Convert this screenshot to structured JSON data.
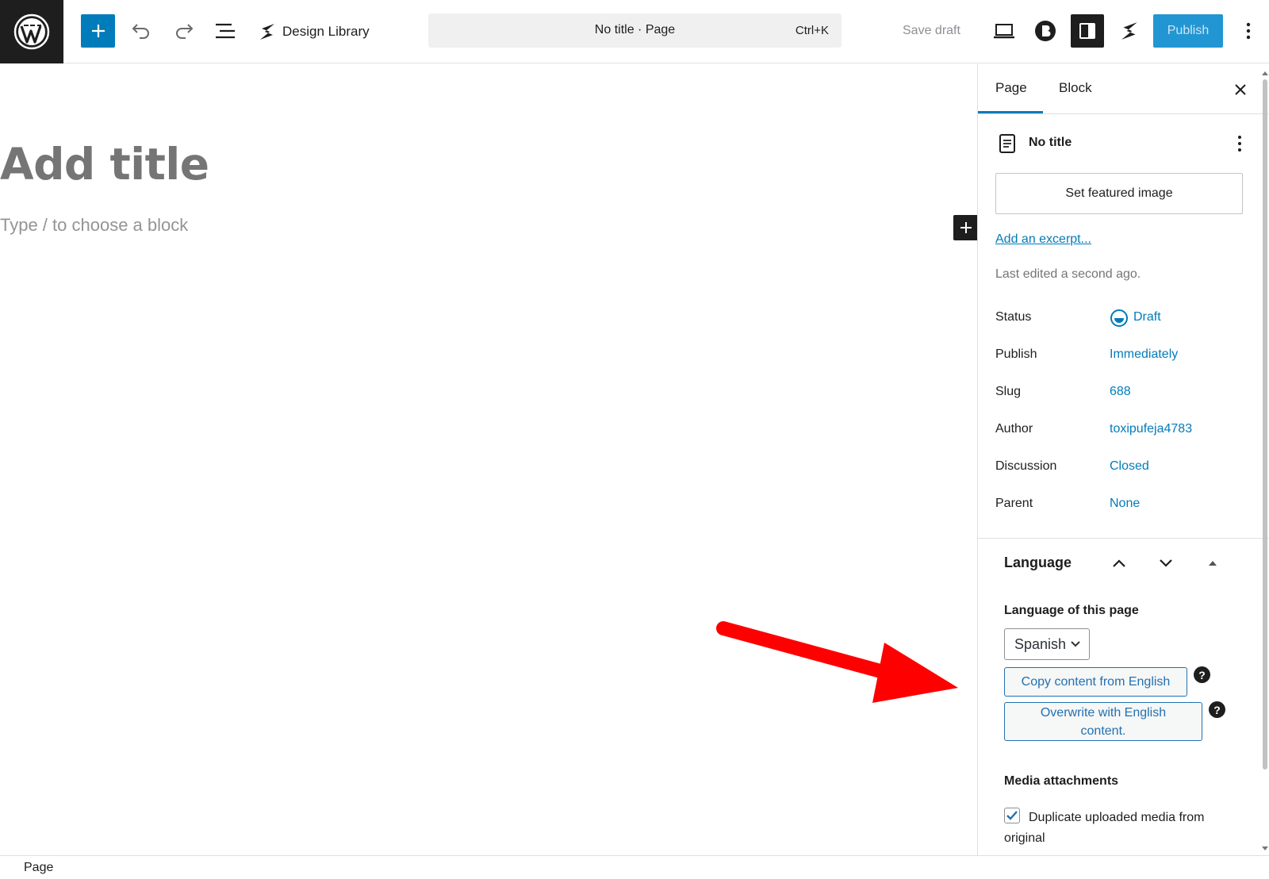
{
  "toolbar": {
    "design_library_label": "Design Library",
    "command_bar_title": "No title · Page",
    "command_bar_shortcut": "Ctrl+K",
    "save_draft_label": "Save draft",
    "publish_label": "Publish"
  },
  "editor": {
    "title_placeholder": "Add title",
    "block_placeholder": "Type / to choose a block"
  },
  "sidebar": {
    "tabs": [
      {
        "label": "Page",
        "active": true
      },
      {
        "label": "Block",
        "active": false
      }
    ],
    "document_title": "No title",
    "featured_image_label": "Set featured image",
    "excerpt_link": "Add an excerpt...",
    "last_edited": "Last edited a second ago.",
    "meta": [
      {
        "label": "Status",
        "value": "Draft"
      },
      {
        "label": "Publish",
        "value": "Immediately"
      },
      {
        "label": "Slug",
        "value": "688"
      },
      {
        "label": "Author",
        "value": "toxipufeja4783"
      },
      {
        "label": "Discussion",
        "value": "Closed"
      },
      {
        "label": "Parent",
        "value": "None"
      }
    ],
    "language_panel": {
      "title": "Language",
      "subtitle": "Language of this page",
      "selected_language": "Spanish",
      "copy_button": "Copy content from English",
      "overwrite_button": "Overwrite with English content.",
      "help_glyph": "?",
      "media_header": "Media attachments",
      "duplicate_media_label": "Duplicate uploaded media from original",
      "duplicate_media_checked": true
    }
  },
  "footer": {
    "breadcrumb": "Page"
  },
  "colors": {
    "accent": "#007cba",
    "publish_bg": "#2196d3",
    "annotation_arrow": "#ff0000"
  }
}
